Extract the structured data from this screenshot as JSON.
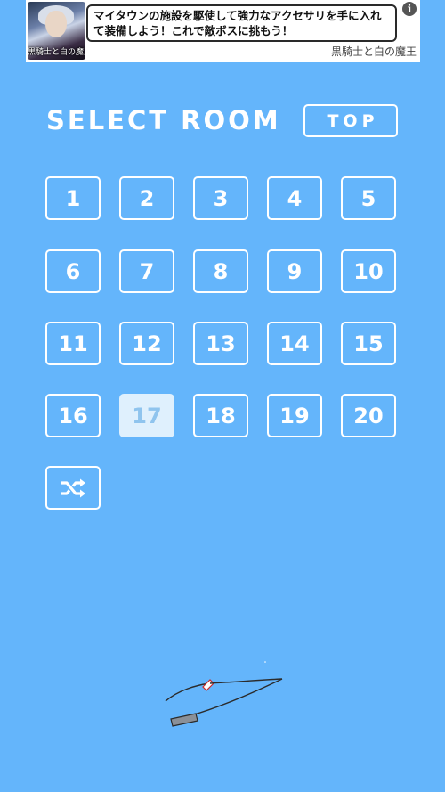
{
  "ad": {
    "thumb_caption": "黒騎士と白の魔王",
    "text": "マイタウンの施設を駆使して強力なアクセサリを手に入れて装備しよう！これで敵ボスに挑もう！",
    "info_icon": "info-icon",
    "brand": "黒騎士と白の魔王"
  },
  "header": {
    "title": "SELECT ROOM",
    "top_button": "TOP"
  },
  "rooms": [
    "1",
    "2",
    "3",
    "4",
    "5",
    "6",
    "7",
    "8",
    "9",
    "10",
    "11",
    "12",
    "13",
    "14",
    "15",
    "16",
    "17",
    "18",
    "19",
    "20"
  ],
  "selected_room": "17",
  "shuffle_icon": "shuffle-icon",
  "colors": {
    "background": "#64b5fb",
    "selected_fill": "#dff0fd",
    "selected_text": "#8fc4ee"
  }
}
